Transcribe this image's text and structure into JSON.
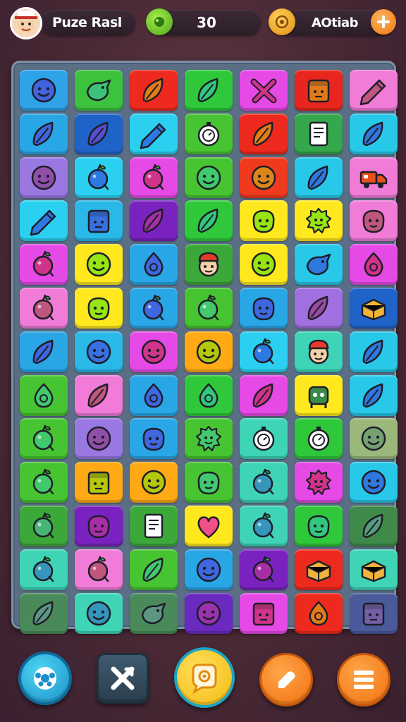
{
  "header": {
    "title": "Puze Rasl",
    "score": "30",
    "coins_label": "AOtiab",
    "avatar_icon": "chef-avatar-icon",
    "score_icon": "green-gem-icon",
    "coin_icon": "gold-coin-icon",
    "add_icon": "plus-icon"
  },
  "board": {
    "columns": 7,
    "rows": [
      [
        [
          "#2fa3e8",
          "smiley-face"
        ],
        [
          "#3cc23c",
          "bird"
        ],
        [
          "#ee2a1e",
          "leaf"
        ],
        [
          "#2fc83a",
          "leaf"
        ],
        [
          "#e64ae6",
          "x-sticks"
        ],
        [
          "#e8261e",
          "box-face"
        ],
        [
          "#f07cd8",
          "pencil"
        ]
      ],
      [
        [
          "#29a6e6",
          "leaf"
        ],
        [
          "#1f63c8",
          "leaf"
        ],
        [
          "#2bd0f0",
          "pencil"
        ],
        [
          "#47c431",
          "compass"
        ],
        [
          "#ee2a1e",
          "leaf"
        ],
        [
          "#34a84a",
          "note-card"
        ],
        [
          "#28c8e8",
          "leaf"
        ]
      ],
      [
        [
          "#9a78e2",
          "smiley-face"
        ],
        [
          "#2bd0f0",
          "berry"
        ],
        [
          "#e64ae6",
          "berry"
        ],
        [
          "#47c431",
          "smiley-face"
        ],
        [
          "#ef3a1e",
          "smiley-face"
        ],
        [
          "#28c8e8",
          "leaf"
        ],
        [
          "#f07cd8",
          "truck"
        ]
      ],
      [
        [
          "#2bd0f0",
          "pencil"
        ],
        [
          "#29b8e8",
          "box-face"
        ],
        [
          "#7a22c0",
          "leaf"
        ],
        [
          "#2fc83a",
          "leaf"
        ],
        [
          "#ffe81e",
          "blob-face"
        ],
        [
          "#ffe81e",
          "gear-blob"
        ],
        [
          "#f07cd8",
          "blob-face"
        ]
      ],
      [
        [
          "#e64ae6",
          "berry"
        ],
        [
          "#ffe81e",
          "smiley-face"
        ],
        [
          "#29a6e6",
          "drop"
        ],
        [
          "#3ca83a",
          "chef-face"
        ],
        [
          "#ffe81e",
          "smiley-face"
        ],
        [
          "#28c8e8",
          "bird"
        ],
        [
          "#e64ae6",
          "drop"
        ]
      ],
      [
        [
          "#f07cd8",
          "berry"
        ],
        [
          "#ffe81e",
          "blob-face"
        ],
        [
          "#29a6e6",
          "berry"
        ],
        [
          "#47c431",
          "berry"
        ],
        [
          "#29a6e6",
          "blob-face"
        ],
        [
          "#a070e0",
          "leaf"
        ],
        [
          "#1f63c8",
          "crate"
        ]
      ],
      [
        [
          "#29a6e6",
          "leaf"
        ],
        [
          "#29b8e8",
          "smiley-face"
        ],
        [
          "#e64ae6",
          "smiley-face"
        ],
        [
          "#ffaa14",
          "smiley-face"
        ],
        [
          "#2bd0f0",
          "berry"
        ],
        [
          "#3fd4b6",
          "chef-face"
        ],
        [
          "#28c8e8",
          "leaf"
        ]
      ],
      [
        [
          "#47c431",
          "drop"
        ],
        [
          "#f07cd8",
          "leaf"
        ],
        [
          "#29a6e6",
          "drop"
        ],
        [
          "#2fc83a",
          "drop"
        ],
        [
          "#e64ae6",
          "leaf"
        ],
        [
          "#ffe81e",
          "robot-face"
        ],
        [
          "#28c8e8",
          "leaf"
        ]
      ],
      [
        [
          "#47c431",
          "berry"
        ],
        [
          "#9a78e2",
          "smiley-face"
        ],
        [
          "#29a6e6",
          "blob-face"
        ],
        [
          "#47c431",
          "gear-blob"
        ],
        [
          "#3fd4b6",
          "compass"
        ],
        [
          "#2fc83a",
          "compass"
        ],
        [
          "#9ab87a",
          "smiley-face"
        ]
      ],
      [
        [
          "#47c431",
          "berry"
        ],
        [
          "#ffaa14",
          "box-face"
        ],
        [
          "#ffaa14",
          "smiley-face"
        ],
        [
          "#47c431",
          "blob-face"
        ],
        [
          "#3fd4b6",
          "berry"
        ],
        [
          "#e64ae6",
          "gear-blob"
        ],
        [
          "#28c8e8",
          "smiley-face"
        ]
      ],
      [
        [
          "#3ca83a",
          "berry"
        ],
        [
          "#7a22c0",
          "blob-face"
        ],
        [
          "#3ca83a",
          "note-card"
        ],
        [
          "#ffe81e",
          "heart"
        ],
        [
          "#3fd4b6",
          "berry"
        ],
        [
          "#2fc83a",
          "blob-face"
        ],
        [
          "#3f8a4a",
          "leaf"
        ]
      ],
      [
        [
          "#3fd4b6",
          "berry"
        ],
        [
          "#f07cd8",
          "berry"
        ],
        [
          "#47c431",
          "leaf"
        ],
        [
          "#29a6e6",
          "smiley-face"
        ],
        [
          "#7a22c0",
          "berry"
        ],
        [
          "#ee2a1e",
          "crate"
        ],
        [
          "#3fd4b6",
          "crate"
        ]
      ],
      [
        [
          "#4a8a5a",
          "leaf"
        ],
        [
          "#3fd4b6",
          "smiley-face"
        ],
        [
          "#4a8a5a",
          "bird"
        ],
        [
          "#6a2ac0",
          "smiley-face"
        ],
        [
          "#e64ae6",
          "box-face"
        ],
        [
          "#ee2a1e",
          "drop"
        ],
        [
          "#4a5a9a",
          "box-face"
        ]
      ]
    ]
  },
  "buttons": {
    "b1_icon": "controller-icon",
    "b2_icon": "shuffle-icon",
    "b3_icon": "hint-icon",
    "b4_icon": "pencil-icon",
    "b5_icon": "menu-icon"
  }
}
